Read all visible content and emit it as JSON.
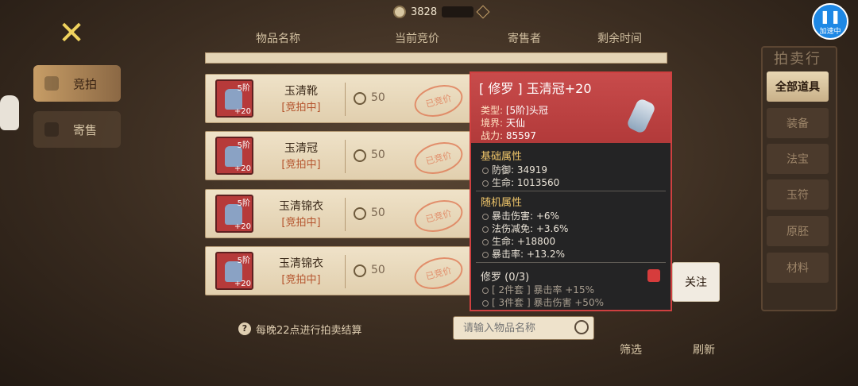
{
  "currency": {
    "amount": "3828",
    "icon": "coin-icon"
  },
  "side_tabs": [
    {
      "label": "竞拍",
      "active": true
    },
    {
      "label": "寄售",
      "active": false
    }
  ],
  "header": {
    "cols": [
      "物品名称",
      "当前竞价",
      "寄售者",
      "剩余时间"
    ]
  },
  "rows": [
    {
      "name": "玉清靴",
      "status": "[竞拍中]",
      "tier": "5阶",
      "level": "+20",
      "bid": "50",
      "stamp": "已竞价"
    },
    {
      "name": "玉清冠",
      "status": "[竞拍中]",
      "tier": "5阶",
      "level": "+20",
      "bid": "50",
      "stamp": "已竞价"
    },
    {
      "name": "玉清锦衣",
      "status": "[竞拍中]",
      "tier": "5阶",
      "level": "+20",
      "bid": "50",
      "stamp": "已竞价"
    },
    {
      "name": "玉清锦衣",
      "status": "[竞拍中]",
      "tier": "5阶",
      "level": "+20",
      "bid": "50",
      "stamp": "已竞价"
    }
  ],
  "right_panel": {
    "title": "拍卖行",
    "filters": [
      "全部道具",
      "装备",
      "法宝",
      "玉符",
      "原胚",
      "材料"
    ],
    "active": "全部道具"
  },
  "tooltip": {
    "title": "[ 修罗 ] 玉清冠+20",
    "type_k": "类型:",
    "type_v": "[5阶]头冠",
    "realm_k": "境界:",
    "realm_v": "天仙",
    "power_k": "战力:",
    "power_v": "85597",
    "base_title": "基础属性",
    "base": [
      "防御:  34919",
      "生命:  1013560"
    ],
    "random_title": "随机属性",
    "random": [
      "暴击伤害:  +6%",
      "法伤减免:  +3.6%",
      "生命:  +18800",
      "暴击率:  +13.2%"
    ],
    "set_title": "修罗 (0/3)",
    "sets": [
      "[ 2件套 ] 暴击率 +15%",
      "[ 3件套 ] 暴击伤害 +50%"
    ]
  },
  "follow_label": "关注",
  "notice": "每晚22点进行拍卖结算",
  "search": {
    "placeholder": "请输入物品名称"
  },
  "filter_label": "筛选",
  "refresh_label": "刷新",
  "speed": {
    "label": "加速中"
  },
  "colors": {
    "accent_red": "#cf4040",
    "gold": "#f0c66a",
    "parchment": "#efe2c8",
    "speed_blue": "#1e88e5"
  }
}
